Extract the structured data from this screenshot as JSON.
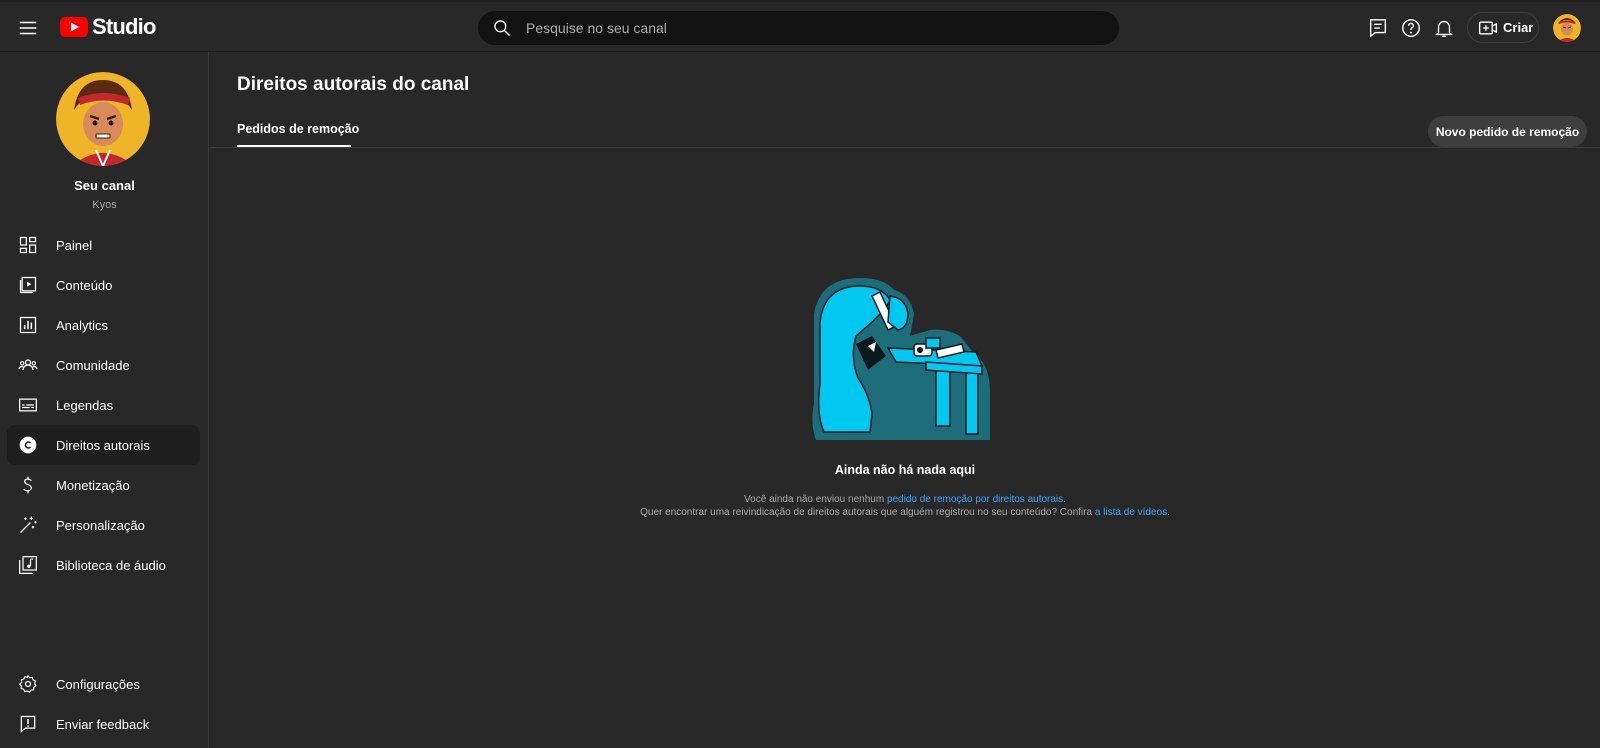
{
  "app": {
    "brand": "Studio",
    "search_placeholder": "Pesquise no seu canal",
    "create_label": "Criar",
    "icons": [
      "menu-icon",
      "youtube-logo-icon",
      "search-icon",
      "comment-icon",
      "help-icon",
      "bell-icon",
      "create-video-icon"
    ]
  },
  "channel": {
    "title": "Seu canal",
    "name": "Kyos"
  },
  "sidebar": {
    "items": [
      {
        "label": "Painel",
        "icon": "dashboard-icon"
      },
      {
        "label": "Conteúdo",
        "icon": "content-icon"
      },
      {
        "label": "Analytics",
        "icon": "analytics-icon"
      },
      {
        "label": "Comunidade",
        "icon": "community-icon"
      },
      {
        "label": "Legendas",
        "icon": "subtitles-icon"
      },
      {
        "label": "Direitos autorais",
        "icon": "copyright-icon",
        "active": true
      },
      {
        "label": "Monetização",
        "icon": "dollar-icon"
      },
      {
        "label": "Personalização",
        "icon": "magic-wand-icon"
      },
      {
        "label": "Biblioteca de áudio",
        "icon": "audio-library-icon"
      }
    ],
    "bottom": [
      {
        "label": "Configurações",
        "icon": "settings-icon"
      },
      {
        "label": "Enviar feedback",
        "icon": "feedback-icon"
      }
    ]
  },
  "main": {
    "title": "Direitos autorais do canal",
    "tab": "Pedidos de remoção",
    "new_request_label": "Novo pedido de remoção",
    "empty": {
      "title": "Ainda não há nada aqui",
      "line1_prefix": "Você ainda não enviou nenhum ",
      "line1_link": "pedido de remoção por direitos autorais",
      "line1_suffix": ".",
      "line2_prefix": "Quer encontrar uma reivindicação de direitos autorais que alguém registrou no seu conteúdo? Confira ",
      "line2_link": "a lista de vídeos",
      "line2_suffix": "."
    }
  },
  "colors": {
    "background": "#282828",
    "search_bg": "#121212",
    "accent_link": "#3ea6ff",
    "brand_red": "#ff0000",
    "illustration_cyan": "#00c8f0",
    "illustration_teal": "#1d6e7a"
  }
}
